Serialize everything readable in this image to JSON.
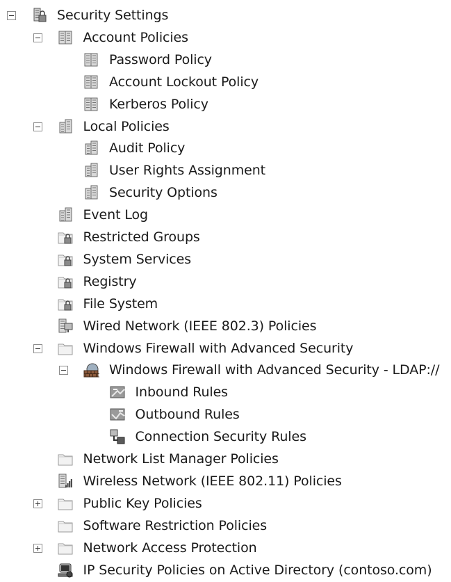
{
  "tree": {
    "items": [
      {
        "label": "Security Settings",
        "level": 0,
        "expander": "expanded",
        "icon": "security-settings-icon"
      },
      {
        "label": "Account Policies",
        "level": 1,
        "expander": "expanded",
        "icon": "policy-icon"
      },
      {
        "label": "Password Policy",
        "level": 2,
        "expander": "none",
        "icon": "policy-icon"
      },
      {
        "label": "Account Lockout Policy",
        "level": 2,
        "expander": "none",
        "icon": "policy-icon"
      },
      {
        "label": "Kerberos Policy",
        "level": 2,
        "expander": "none",
        "icon": "policy-icon"
      },
      {
        "label": "Local Policies",
        "level": 1,
        "expander": "expanded",
        "icon": "local-policy-icon"
      },
      {
        "label": "Audit Policy",
        "level": 2,
        "expander": "none",
        "icon": "local-policy-icon"
      },
      {
        "label": "User Rights Assignment",
        "level": 2,
        "expander": "none",
        "icon": "local-policy-icon"
      },
      {
        "label": "Security Options",
        "level": 2,
        "expander": "none",
        "icon": "local-policy-icon"
      },
      {
        "label": "Event Log",
        "level": 1,
        "expander": "none",
        "icon": "local-policy-icon"
      },
      {
        "label": "Restricted Groups",
        "level": 1,
        "expander": "none",
        "icon": "locked-folder-icon"
      },
      {
        "label": "System Services",
        "level": 1,
        "expander": "none",
        "icon": "locked-folder-icon"
      },
      {
        "label": "Registry",
        "level": 1,
        "expander": "none",
        "icon": "locked-folder-icon"
      },
      {
        "label": "File System",
        "level": 1,
        "expander": "none",
        "icon": "locked-folder-icon"
      },
      {
        "label": "Wired Network (IEEE 802.3) Policies",
        "level": 1,
        "expander": "none",
        "icon": "wired-network-icon"
      },
      {
        "label": "Windows Firewall with Advanced Security",
        "level": 1,
        "expander": "expanded",
        "icon": "folder-icon"
      },
      {
        "label": "Windows Firewall with Advanced Security - LDAP://",
        "level": 2,
        "expander": "expanded",
        "icon": "firewall-icon"
      },
      {
        "label": "Inbound Rules",
        "level": 3,
        "expander": "none",
        "icon": "inbound-rules-icon"
      },
      {
        "label": "Outbound Rules",
        "level": 3,
        "expander": "none",
        "icon": "outbound-rules-icon"
      },
      {
        "label": "Connection Security Rules",
        "level": 3,
        "expander": "none",
        "icon": "connection-security-icon"
      },
      {
        "label": "Network List Manager Policies",
        "level": 1,
        "expander": "none",
        "icon": "folder-icon"
      },
      {
        "label": "Wireless Network (IEEE 802.11) Policies",
        "level": 1,
        "expander": "none",
        "icon": "wireless-network-icon"
      },
      {
        "label": "Public Key Policies",
        "level": 1,
        "expander": "collapsed",
        "icon": "folder-icon"
      },
      {
        "label": "Software Restriction Policies",
        "level": 1,
        "expander": "none",
        "icon": "folder-icon"
      },
      {
        "label": "Network Access Protection",
        "level": 1,
        "expander": "collapsed",
        "icon": "folder-icon"
      },
      {
        "label": "IP Security Policies on Active Directory (contoso.com)",
        "level": 1,
        "expander": "none",
        "icon": "ip-security-icon"
      }
    ]
  }
}
